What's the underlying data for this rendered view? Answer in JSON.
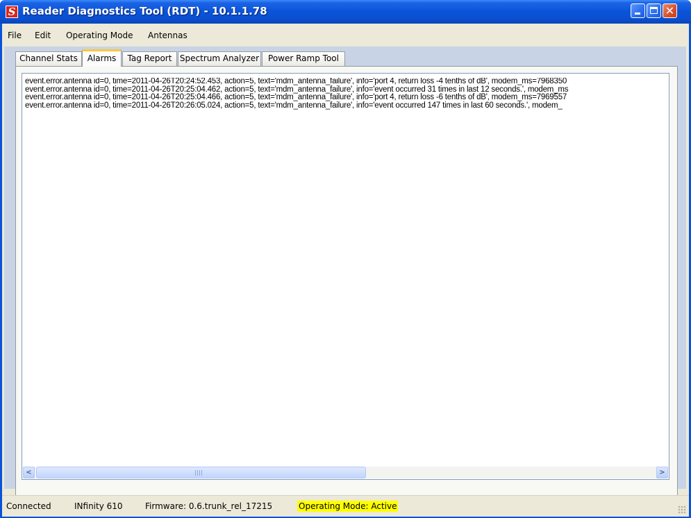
{
  "window": {
    "title": "Reader Diagnostics Tool (RDT) - 10.1.1.78",
    "app_icon_letter": "S"
  },
  "menu": {
    "items": [
      {
        "label": "File"
      },
      {
        "label": "Edit"
      },
      {
        "label": "Operating Mode"
      },
      {
        "label": "Antennas"
      }
    ]
  },
  "tabs": [
    {
      "label": "Channel Stats",
      "active": false
    },
    {
      "label": "Alarms",
      "active": true
    },
    {
      "label": "Tag Report",
      "active": false
    },
    {
      "label": "Spectrum Analyzer",
      "active": false
    },
    {
      "label": "Power Ramp Tool",
      "active": false
    }
  ],
  "alarms": {
    "lines": [
      "event.error.antenna id=0, time=2011-04-26T20:24:52.453, action=5, text='mdm_antenna_failure', info='port 4, return loss -4 tenths of dB', modem_ms=7968350",
      "event.error.antenna id=0, time=2011-04-26T20:25:04.462, action=5, text='mdm_antenna_failure', info='event occurred 31 times in last 12 seconds.', modem_ms",
      "event.error.antenna id=0, time=2011-04-26T20:25:04.466, action=5, text='mdm_antenna_failure', info='port 4, return loss -6 tenths of dB', modem_ms=7969557",
      "event.error.antenna id=0, time=2011-04-26T20:26:05.024, action=5, text='mdm_antenna_failure', info='event occurred 147 times in last 60 seconds.', modem_"
    ]
  },
  "status": {
    "connection": "Connected",
    "device": "INfinity 610",
    "firmware": "Firmware: 0.6.trunk_rel_17215",
    "operating_mode": "Operating Mode: Active",
    "highlight_color": "#ffff00"
  },
  "colors": {
    "titlebar": "#0a53d8",
    "window_bg": "#ece9d8",
    "active_tab_accent": "#ffc73c",
    "close_button": "#d9502d"
  }
}
